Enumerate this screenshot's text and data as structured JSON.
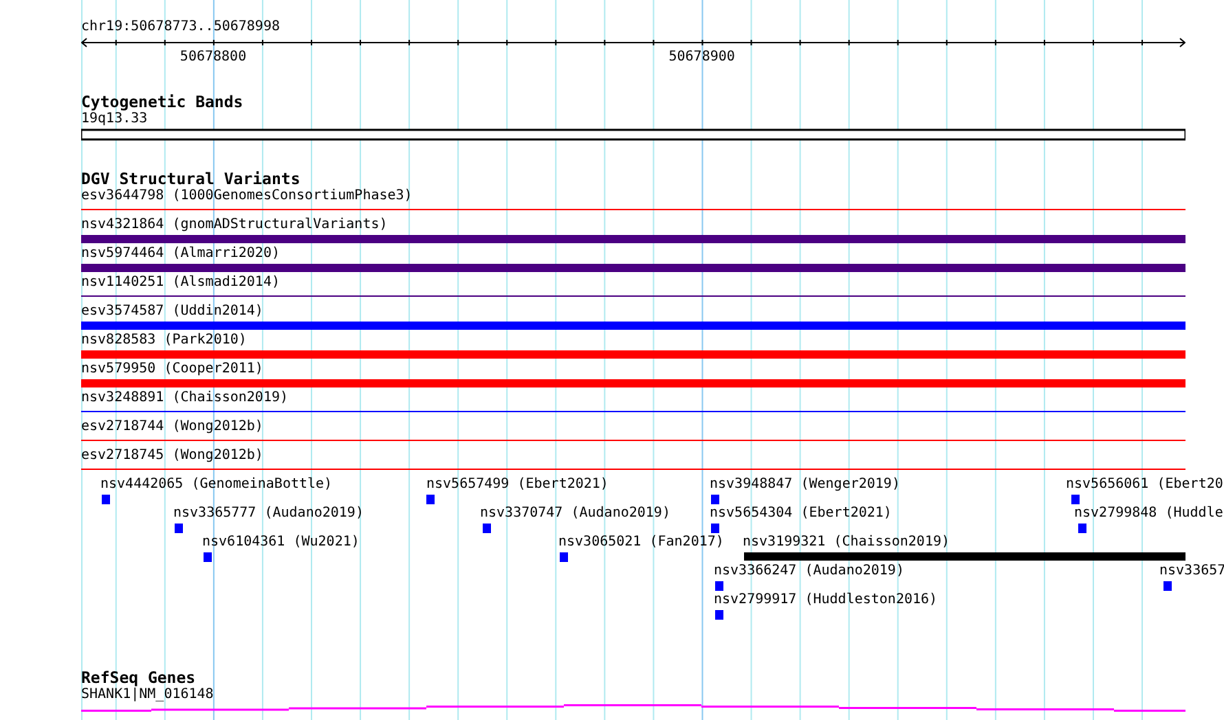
{
  "ruler": {
    "location": "chr19:50678773..50678998",
    "tick_labels": [
      "50678800",
      "50678900"
    ]
  },
  "cytogenetic_bands": {
    "title": "Cytogenetic Bands",
    "band": "19q13.33"
  },
  "dgv_structural_variants": {
    "title": "DGV Structural Variants",
    "rows": [
      {
        "label": "esv3644798 (1000GenomesConsortiumPhase3)",
        "kind": "line",
        "color": "#ff0000"
      },
      {
        "label": "nsv4321864 (gnomADStructuralVariants)",
        "kind": "block",
        "color": "#4b0082"
      },
      {
        "label": "nsv5974464 (Almarri2020)",
        "kind": "block",
        "color": "#4b0082"
      },
      {
        "label": "nsv1140251 (Alsmadi2014)",
        "kind": "line",
        "color": "#4b0082"
      },
      {
        "label": "esv3574587 (Uddin2014)",
        "kind": "block",
        "color": "#0000ff"
      },
      {
        "label": "nsv828583 (Park2010)",
        "kind": "block",
        "color": "#ff0000"
      },
      {
        "label": "nsv579950 (Cooper2011)",
        "kind": "block",
        "color": "#ff0000"
      },
      {
        "label": "nsv3248891 (Chaisson2019)",
        "kind": "line",
        "color": "#0000ff"
      },
      {
        "label": "esv2718744 (Wong2012b)",
        "kind": "line",
        "color": "#ff0000"
      },
      {
        "label": "esv2718745 (Wong2012b)",
        "kind": "line",
        "color": "#ff0000"
      }
    ],
    "lanes": [
      [
        {
          "label": "nsv4442065 (GenomeinaBottle)",
          "kind": "point",
          "color": "#0000ff"
        },
        {
          "label": "nsv5657499 (Ebert2021)",
          "kind": "point",
          "color": "#0000ff"
        },
        {
          "label": "nsv3948847 (Wenger2019)",
          "kind": "point",
          "color": "#0000ff"
        },
        {
          "label": "nsv5656061 (Ebert20",
          "kind": "point",
          "color": "#0000ff"
        }
      ],
      [
        {
          "label": "nsv3365777 (Audano2019)",
          "kind": "point",
          "color": "#0000ff"
        },
        {
          "label": "nsv3370747 (Audano2019)",
          "kind": "point",
          "color": "#0000ff"
        },
        {
          "label": "nsv5654304 (Ebert2021)",
          "kind": "point",
          "color": "#0000ff"
        },
        {
          "label": "nsv2799848 (Huddle",
          "kind": "point",
          "color": "#0000ff"
        }
      ],
      [
        {
          "label": "nsv6104361 (Wu2021)",
          "kind": "point",
          "color": "#0000ff"
        },
        {
          "label": "nsv3065021 (Fan2017)",
          "kind": "point",
          "color": "#0000ff"
        },
        {
          "label": "nsv3199321 (Chaisson2019)",
          "kind": "span",
          "color": "#000000"
        }
      ],
      [
        {
          "label": "nsv3366247 (Audano2019)",
          "kind": "point",
          "color": "#0000ff"
        },
        {
          "label": "nsv33657",
          "kind": "point",
          "color": "#0000ff"
        }
      ],
      [
        {
          "label": "nsv2799917 (Huddleston2016)",
          "kind": "point",
          "color": "#0000ff"
        }
      ]
    ]
  },
  "refseq_genes": {
    "title": "RefSeq Genes",
    "gene": "SHANK1|NM_016148"
  }
}
